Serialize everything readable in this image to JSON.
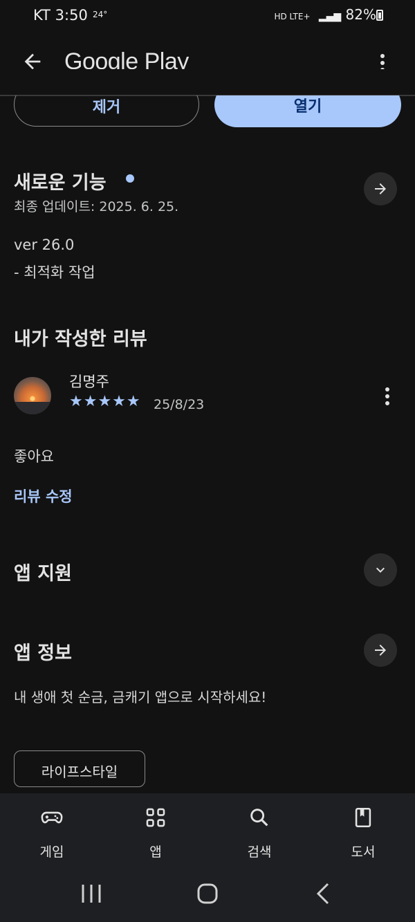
{
  "status_bar": {
    "carrier": "KT",
    "time": "3:50",
    "temperature": "24°",
    "network": "HD LTE+",
    "battery": "82%"
  },
  "app_bar": {
    "title": "Google Play",
    "back_icon": "arrow-back-icon",
    "menu_icon": "more-vert-icon"
  },
  "actions": {
    "uninstall_label": "제거",
    "open_label": "열기"
  },
  "whats_new": {
    "title": "새로운 기능",
    "last_updated": "최종 업데이트: 2025. 6. 25.",
    "version": "ver 26.0",
    "notes": "- 최적화 작업"
  },
  "my_review": {
    "title": "내가 작성한 리뷰",
    "author": "김명주",
    "stars": "★★★★★",
    "rating": 5,
    "date": "25/8/23",
    "text": "좋아요",
    "edit_label": "리뷰 수정"
  },
  "app_support": {
    "title": "앱 지원"
  },
  "app_info": {
    "title": "앱 정보",
    "description": "내 생애 첫 순금, 금캐기 앱으로 시작하세요!",
    "category_chip": "라이프스타일"
  },
  "bottom_nav": [
    {
      "label": "게임",
      "icon": "gamepad-icon"
    },
    {
      "label": "앱",
      "icon": "apps-grid-icon"
    },
    {
      "label": "검색",
      "icon": "search-icon"
    },
    {
      "label": "도서",
      "icon": "book-icon"
    }
  ],
  "colors": {
    "background": "#121212",
    "accent": "#a8c7fa",
    "on_accent": "#062e6f",
    "nav_bg": "#1e1f22"
  }
}
